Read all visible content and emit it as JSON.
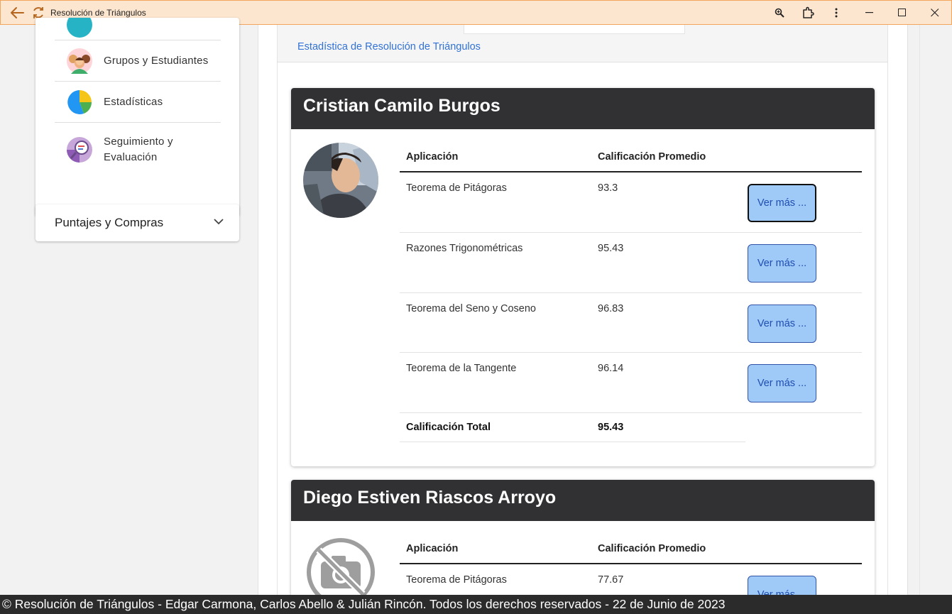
{
  "window": {
    "title": "Resolución de Triángulos",
    "accent": "#f2a55d"
  },
  "sidebar": {
    "items": [
      {
        "label": "Grupos y Estudiantes",
        "icon": "students-group-icon"
      },
      {
        "label": "Estadísticas",
        "icon": "pie-chart-icon"
      },
      {
        "label": "Seguimiento y Evaluación",
        "icon": "evaluation-icon"
      }
    ],
    "accordion": {
      "title": "Puntajes y Compras"
    }
  },
  "main": {
    "tab_link": "Estadística de Resolución de Triángulos",
    "students": [
      {
        "name": "Cristian Camilo Burgos",
        "has_photo": true,
        "headers": {
          "app": "Aplicación",
          "grade": "Calificación Promedio"
        },
        "rows": [
          {
            "app": "Teorema de Pitágoras",
            "grade": "93.3",
            "button": "Ver más ..."
          },
          {
            "app": "Razones Trigonométricas",
            "grade": "95.43",
            "button": "Ver más ..."
          },
          {
            "app": "Teorema del Seno y Coseno",
            "grade": "96.83",
            "button": "Ver más ..."
          },
          {
            "app": "Teorema de la Tangente",
            "grade": "96.14",
            "button": "Ver más ..."
          }
        ],
        "total_label": "Calificación Total",
        "total_value": "95.43"
      },
      {
        "name": "Diego Estiven Riascos Arroyo",
        "has_photo": false,
        "headers": {
          "app": "Aplicación",
          "grade": "Calificación Promedio"
        },
        "rows": [
          {
            "app": "Teorema de Pitágoras",
            "grade": "77.67",
            "button": "Ver más ..."
          }
        ]
      }
    ]
  },
  "footer": {
    "text": "© Resolución de Triángulos - Edgar Carmona, Carlos Abello & Julián Rincón. Todos los derechos reservados - 22 de Junio de 2023"
  }
}
